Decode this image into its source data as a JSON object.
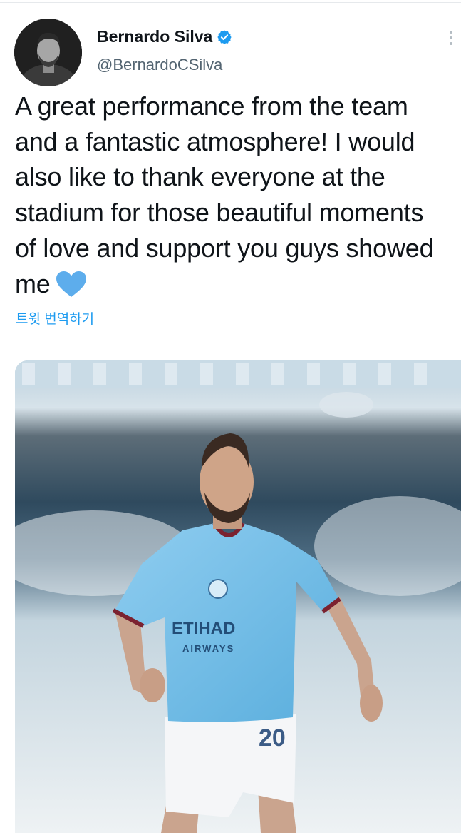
{
  "tweet": {
    "author": {
      "display_name": "Bernardo Silva",
      "handle": "@BernardoCSilva",
      "verified": true,
      "avatar_icon": "profile-photo"
    },
    "text_lines": [
      "A great performance from the team",
      "and a fantastic atmosphere! I would",
      "also like to thank everyone at the",
      "stadium for those beautiful moments",
      "of love and support you guys showed",
      "me"
    ],
    "emoji": "blue-heart-icon",
    "translate_label": "트윗 번역하기",
    "media": {
      "description_icon": "photo-player",
      "shirt_sponsor_line1": "ETIHAD",
      "shirt_sponsor_line2": "AIRWAYS",
      "shorts_number": "20"
    }
  },
  "colors": {
    "text": "#0f1419",
    "muted": "#536471",
    "link": "#1d9bf0",
    "verified": "#1d9bf0",
    "heart": "#5dadec",
    "jersey": "#7cc0ea"
  }
}
